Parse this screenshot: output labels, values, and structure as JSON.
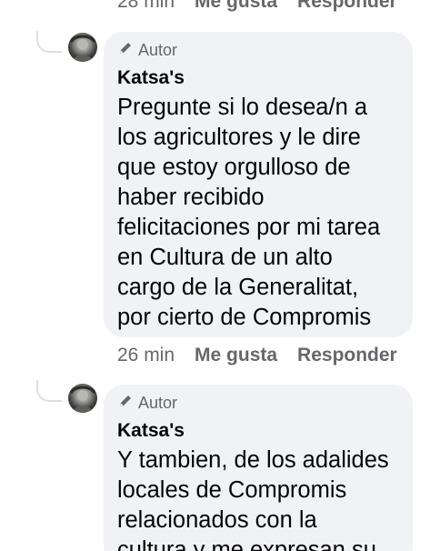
{
  "previous_comment_actions": {
    "time": "28 min",
    "like": "Me gusta",
    "reply": "Responder"
  },
  "comments": [
    {
      "badge": "Autor",
      "author": "Katsa's",
      "text": "Pregunte si lo desea/n a\nlos agricultores y le dire\nque estoy orgulloso de\nhaber recibido\nfelicitaciones  por mi tarea\nen Cultura de un alto\ncargo de la Generalitat,\npor cierto de Compromis",
      "time": "26 min",
      "like": "Me gusta",
      "reply": "Responder"
    },
    {
      "badge": "Autor",
      "author": "Katsa's",
      "text": "Y tambien, de los adalides\nlocales de Compromis\nrelacionados con la\ncultura y me expresan su"
    }
  ],
  "icons": {
    "badge_icon": "pencil-icon"
  },
  "colors": {
    "bubble": "#f0f2f5",
    "secondary_text": "#65676b",
    "primary_text": "#050505"
  }
}
